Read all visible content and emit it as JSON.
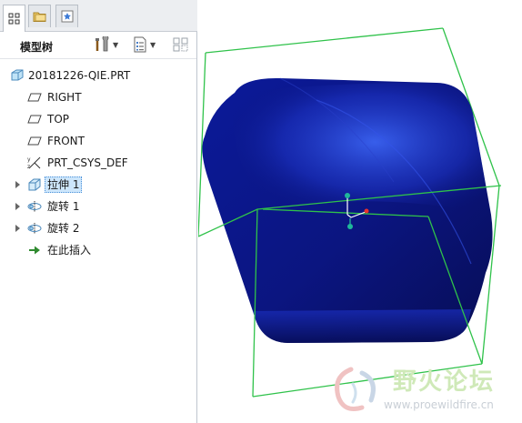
{
  "tabs": [
    {
      "name": "model-tree-tab",
      "icon": "model-tree-icon",
      "active": true
    },
    {
      "name": "folder-browser-tab",
      "icon": "folder-icon",
      "active": false
    },
    {
      "name": "favorites-tab",
      "icon": "favorites-star-icon",
      "active": false
    }
  ],
  "toolbar": {
    "title": "模型树",
    "buttons": [
      {
        "name": "settings-button",
        "icon": "tools-icon"
      },
      {
        "name": "show-button",
        "icon": "list-icon"
      },
      {
        "name": "filter-button",
        "icon": "filter-grid-icon"
      }
    ]
  },
  "tree": {
    "root": {
      "label": "20181226-QIE.PRT",
      "icon": "part-icon"
    },
    "items": [
      {
        "label": "RIGHT",
        "icon": "datum-plane-icon",
        "expandable": false,
        "selected": false
      },
      {
        "label": "TOP",
        "icon": "datum-plane-icon",
        "expandable": false,
        "selected": false
      },
      {
        "label": "FRONT",
        "icon": "datum-plane-icon",
        "expandable": false,
        "selected": false
      },
      {
        "label": "PRT_CSYS_DEF",
        "icon": "csys-icon",
        "expandable": false,
        "selected": false
      },
      {
        "label": "拉伸 1",
        "icon": "extrude-icon",
        "expandable": true,
        "selected": true
      },
      {
        "label": "旋转 1",
        "icon": "revolve-icon",
        "expandable": true,
        "selected": false
      },
      {
        "label": "旋转 2",
        "icon": "revolve-icon",
        "expandable": true,
        "selected": false
      },
      {
        "label": "在此插入",
        "icon": "insert-arrow-icon",
        "expandable": false,
        "selected": false
      }
    ]
  },
  "watermark": {
    "text": "野火论坛",
    "url": "www.proewildfire.cn"
  },
  "colors": {
    "solid_dark": "#0a1270",
    "solid_light": "#2a4fe0",
    "bounding_box": "#2fc24a",
    "dragger_teal": "#1fb79a",
    "dragger_red": "#e8322c",
    "selection_fill": "#cde6fb"
  }
}
